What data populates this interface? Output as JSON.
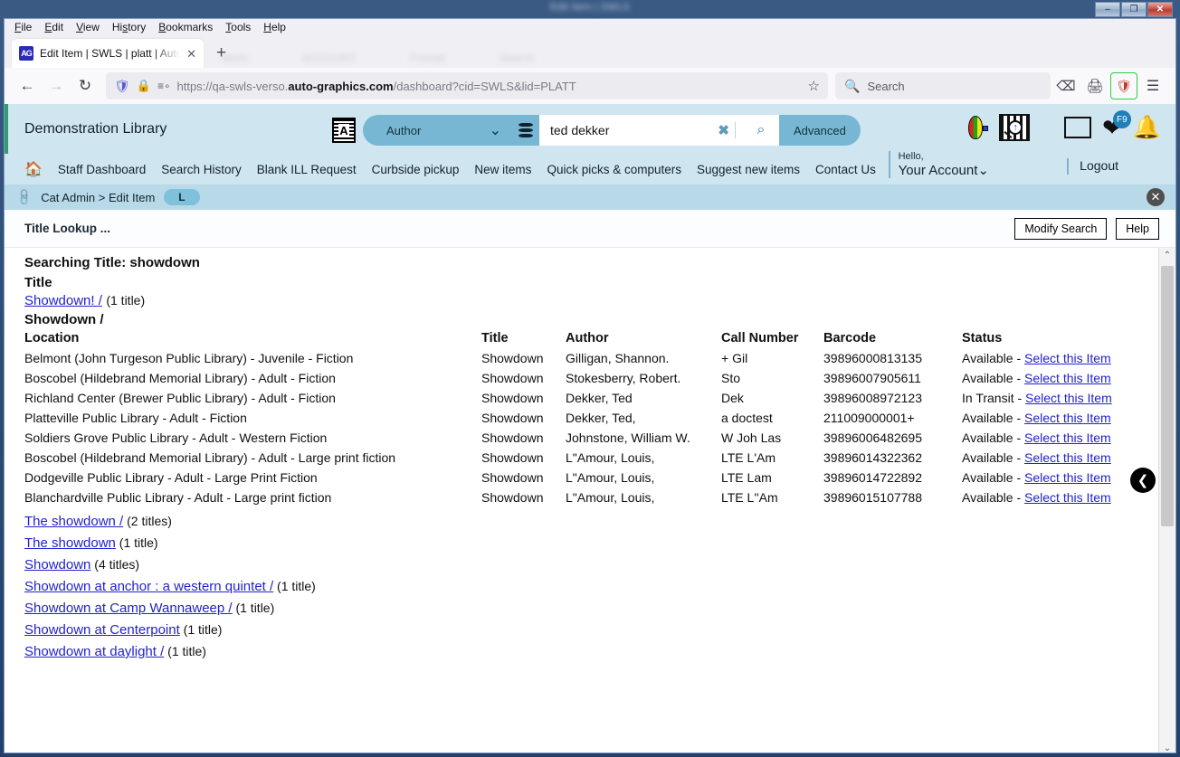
{
  "os_window": {
    "title": "Edit Item | SWLS",
    "minimize_label": "–",
    "maximize_label": "❐",
    "close_label": "✕"
  },
  "browser": {
    "menus": [
      "File",
      "Edit",
      "View",
      "History",
      "Bookmarks",
      "Tools",
      "Help"
    ],
    "tab": {
      "favicon": "book-favicon",
      "title": "Edit Item | SWLS | platt | Auto-G",
      "close_label": "✕"
    },
    "new_tab_label": "+",
    "nav": {
      "back_icon": "←",
      "forward_icon": "→",
      "reload_icon": "↻",
      "shield_icon": "shield-icon",
      "lock_icon": "lock-icon",
      "permissions_icon": "permissions-icon",
      "bookmark_icon": "☆"
    },
    "url": {
      "prefix": "https://qa-swls-verso.",
      "domain": "auto-graphics.com",
      "suffix": "/dashboard?cid=SWLS&lid=PLATT"
    },
    "search": {
      "placeholder": "Search",
      "icon": "search-icon"
    },
    "toolbar_icons": [
      "save-to-pocket-icon",
      "print-icon",
      "extension-icon",
      "app-menu-icon"
    ]
  },
  "app_header": {
    "library_name": "Demonstration Library",
    "translate_icon": "translate-icon",
    "scope_selected": "Author",
    "scope_caret": "⌄",
    "database_icon": "database-icon",
    "query_value": "ted dekker",
    "query_clear": "✖",
    "search_icon": "⌕",
    "advanced_label": "Advanced",
    "icons": {
      "balloon": "hot-air-balloon-icon",
      "mag_library": "magnify-library-icon",
      "lists": "lists-icon",
      "favorites": "heart-icon",
      "favorites_badge": "F9",
      "notifications": "bell-icon"
    },
    "account": {
      "hello": "Hello,",
      "name": "Your Account",
      "caret": "⌄"
    },
    "logout": "Logout"
  },
  "nav_row": {
    "home_icon": "home-icon",
    "items": [
      "Staff Dashboard",
      "Search History",
      "Blank ILL Request",
      "Curbside pickup",
      "New items",
      "Quick picks & computers",
      "Suggest new items",
      "Contact Us"
    ]
  },
  "breadcrumb": {
    "link_icon": "link-icon",
    "text": "Cat Admin > Edit Item",
    "pill": "L",
    "close_icon": "✕"
  },
  "lookup_bar": {
    "label": "Title Lookup ...",
    "modify_search": "Modify Search",
    "help": "Help"
  },
  "results": {
    "searching_header": "Searching Title: showdown",
    "title_column_header": "Title",
    "first_group": {
      "link": "Showdown! /",
      "count": "(1 title)"
    },
    "subgroup_title": "Showdown /",
    "table_headers": {
      "location": "Location",
      "title": "Title",
      "author": "Author",
      "call_number": "Call Number",
      "barcode": "Barcode",
      "status": "Status"
    },
    "select_link": "Select this Item",
    "status_sep": " - ",
    "rows": [
      {
        "location": "Belmont (John Turgeson Public Library) - Juvenile - Fiction",
        "title": "Showdown",
        "author": "Gilligan, Shannon.",
        "call_number": "+ Gil",
        "barcode": "39896000813135",
        "status": "Available"
      },
      {
        "location": "Boscobel (Hildebrand Memorial Library) - Adult - Fiction",
        "title": "Showdown",
        "author": "Stokesberry, Robert.",
        "call_number": "Sto",
        "barcode": "39896007905611",
        "status": "Available"
      },
      {
        "location": "Richland Center (Brewer Public Library) - Adult - Fiction",
        "title": "Showdown",
        "author": "Dekker, Ted",
        "call_number": "Dek",
        "barcode": "39896008972123",
        "status": "In Transit"
      },
      {
        "location": "Platteville Public Library - Adult - Fiction",
        "title": "Showdown",
        "author": "Dekker, Ted,",
        "call_number": "a doctest",
        "barcode": "211009000001+",
        "status": "Available"
      },
      {
        "location": "Soldiers Grove Public Library - Adult - Western Fiction",
        "title": "Showdown",
        "author": "Johnstone, William W.",
        "call_number": "W Joh Las",
        "barcode": "39896006482695",
        "status": "Available"
      },
      {
        "location": "Boscobel (Hildebrand Memorial Library) - Adult - Large print fiction",
        "title": "Showdown",
        "author": "L\"Amour, Louis,",
        "call_number": "LTE L'Am",
        "barcode": "39896014322362",
        "status": "Available"
      },
      {
        "location": "Dodgeville Public Library - Adult - Large Print Fiction",
        "title": "Showdown",
        "author": "L\"Amour, Louis,",
        "call_number": "LTE Lam",
        "barcode": "39896014722892",
        "status": "Available"
      },
      {
        "location": "Blanchardville Public Library - Adult - Large print fiction",
        "title": "Showdown",
        "author": "L\"Amour, Louis,",
        "call_number": "LTE L''Am",
        "barcode": "39896015107788",
        "status": "Available"
      }
    ],
    "other_groups": [
      {
        "link": "The showdown /",
        "count": "(2 titles)"
      },
      {
        "link": "The showdown",
        "count": "(1 title)"
      },
      {
        "link": "Showdown",
        "count": "(4 titles)"
      },
      {
        "link": "Showdown at anchor : a western quintet /",
        "count": "(1 title)"
      },
      {
        "link": "Showdown at Camp Wannaweep /",
        "count": "(1 title)"
      },
      {
        "link": "Showdown at Centerpoint",
        "count": "(1 title)"
      },
      {
        "link": "Showdown at daylight /",
        "count": "(1 title)"
      }
    ]
  },
  "scrollbar": {
    "up_icon": "⌃",
    "down_icon": "⌄"
  },
  "float_back_button": {
    "icon": "❮",
    "name": "collapse-panel-button"
  },
  "colors": {
    "header_bg": "#cfe5ef",
    "accent": "#77b7d3",
    "crumb_bg": "#b8d9e8",
    "link": "#2222cc",
    "badge": "#1f7fb8"
  }
}
